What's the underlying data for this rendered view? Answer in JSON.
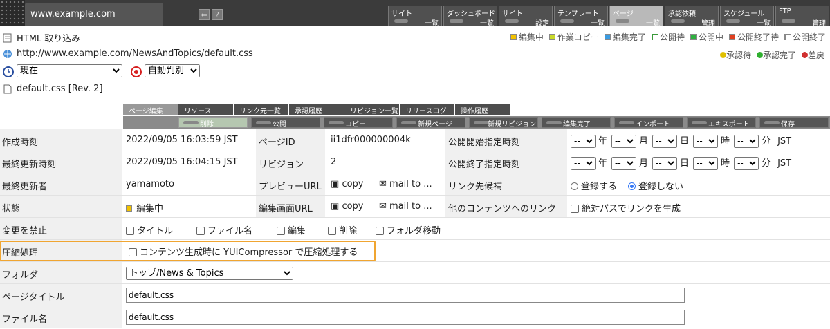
{
  "topbar": {
    "site_name": "www.example.com",
    "back_icon": "back-icon",
    "help_label": "?",
    "menus": [
      {
        "l1": "サイト",
        "l2": "一覧"
      },
      {
        "l1": "ダッシュボード",
        "l2": "一覧"
      },
      {
        "l1": "サイト",
        "l2": "設定"
      },
      {
        "l1": "テンプレート",
        "l2": "一覧"
      },
      {
        "l1": "ページ",
        "l2": "一覧"
      },
      {
        "l1": "承認依頼",
        "l2": "管理"
      },
      {
        "l1": "スケジュール",
        "l2": "一覧"
      },
      {
        "l1": "FTP",
        "l2": "管理"
      }
    ]
  },
  "header": {
    "import_label": "HTML 取り込み",
    "url": "http://www.example.com/NewsAndTopics/default.css",
    "time_select": "現在",
    "encoding_select": "自動判別",
    "file_name": "default.css [Rev. 2]"
  },
  "legend": [
    {
      "label": "編集中",
      "color": "#f2c200"
    },
    {
      "label": "作業コピー",
      "color": "#c9d92a"
    },
    {
      "label": "編集完了",
      "color": "#3b9be0"
    },
    {
      "label": "公開待",
      "color": "#3a9a3a"
    },
    {
      "label": "公開中",
      "color": "#2fb040"
    },
    {
      "label": "公開終了待",
      "color": "#e04020"
    },
    {
      "label": "公開終了",
      "color": "#888888"
    }
  ],
  "legend2": [
    {
      "label": "承認待",
      "color": "#e0c000"
    },
    {
      "label": "承認完了",
      "color": "#30b030"
    },
    {
      "label": "差戻",
      "color": "#d03030"
    }
  ],
  "tabs": [
    "ページ編集",
    "リソース",
    "リンク元一覧",
    "承認履歴",
    "リビジョン一覧",
    "リリースログ",
    "操作履歴"
  ],
  "actions": [
    "削除",
    "公開",
    "コピー",
    "新規ページ",
    "新規リビジョン",
    "編集完了",
    "インポート",
    "エキスポート",
    "保存"
  ],
  "form": {
    "created_label": "作成時刻",
    "created_value": "2022/09/05 16:03:59 JST",
    "page_id_label": "ページID",
    "page_id_value": "ii1dfr000000004k",
    "pub_start_label": "公開開始指定時刻",
    "updated_label": "最終更新時刻",
    "updated_value": "2022/09/05 16:04:15 JST",
    "revision_label": "リビジョン",
    "revision_value": "2",
    "pub_end_label": "公開終了指定時刻",
    "dt_blank": "--",
    "dt_units": [
      "年",
      "月",
      "日",
      "時",
      "分",
      "JST"
    ],
    "updater_label": "最終更新者",
    "updater_value": "yamamoto",
    "preview_label": "プレビューURL",
    "copy_label": "copy",
    "mail_label": "mail to ...",
    "link_label": "リンク先候補",
    "register_label": "登録する",
    "no_register_label": "登録しない",
    "status_label": "状態",
    "status_value": "編集中",
    "edit_url_label": "編集画面URL",
    "other_link_label": "他のコンテンツへのリンク",
    "absolute_path_label": "絶対パスでリンクを生成",
    "lock_label": "変更を禁止",
    "lock_options": [
      "タイトル",
      "ファイル名",
      "編集",
      "削除",
      "フォルダ移動"
    ],
    "compress_label": "圧縮処理",
    "compress_option": "コンテンツ生成時に YUICompressor で圧縮処理する",
    "folder_label": "フォルダ",
    "folder_value": "トップ/News & Topics",
    "page_title_label": "ページタイトル",
    "page_title_value": "default.css",
    "file_name_label": "ファイル名",
    "file_name_value": "default.css"
  }
}
